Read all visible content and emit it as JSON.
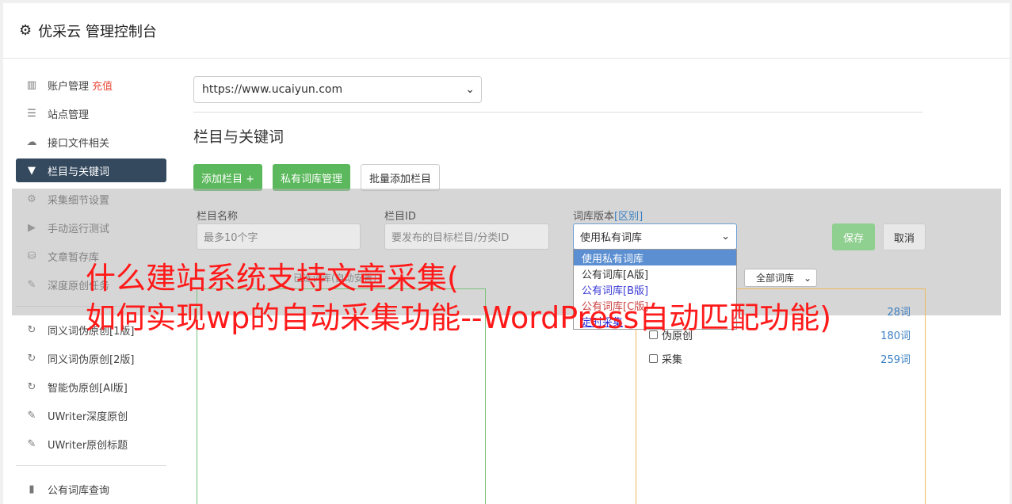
{
  "header": {
    "title": "优采云 管理控制台",
    "icon": "gear-icon"
  },
  "sidebar": {
    "groups": [
      [
        {
          "label": "账户管理",
          "extra": "充值",
          "icon": "bar-chart-icon",
          "glyph": "▥"
        },
        {
          "label": "站点管理",
          "icon": "server-icon",
          "glyph": "☰"
        },
        {
          "label": "接口文件相关",
          "icon": "cloud-upload-icon",
          "glyph": "☁"
        },
        {
          "label": "栏目与关键词",
          "icon": "filter-icon",
          "glyph": "▼",
          "active": true
        },
        {
          "label": "采集细节设置",
          "icon": "cogs-icon",
          "glyph": "⚙"
        },
        {
          "label": "手动运行测试",
          "icon": "play-icon",
          "glyph": "▶"
        },
        {
          "label": "文章暂存库",
          "icon": "database-icon",
          "glyph": "⛁"
        },
        {
          "label": "深度原创任务",
          "icon": "edit-icon",
          "glyph": "✎"
        }
      ],
      [
        {
          "label": "同义词伪原创[1版]",
          "icon": "refresh-icon",
          "glyph": "↻"
        },
        {
          "label": "同义词伪原创[2版]",
          "icon": "refresh-icon",
          "glyph": "↻"
        },
        {
          "label": "智能伪原创[AI版]",
          "icon": "refresh-icon",
          "glyph": "↻"
        },
        {
          "label": "UWriter深度原创",
          "icon": "edit-icon",
          "glyph": "✎"
        },
        {
          "label": "UWriter原创标题",
          "icon": "edit-icon",
          "glyph": "✎"
        }
      ],
      [
        {
          "label": "公有词库查询",
          "icon": "book-icon",
          "glyph": "▮"
        }
      ]
    ]
  },
  "main": {
    "site_select": "https://www.ucaiyun.com",
    "section_title": "栏目与关键词",
    "buttons": {
      "add_column": "添加栏目 +",
      "private_lib": "私有词库管理",
      "batch_add": "批量添加栏目"
    },
    "form": {
      "col_name_label": "栏目名称",
      "col_name_placeholder": "最多10个字",
      "col_id_label": "栏目ID",
      "col_id_placeholder": "要发布的目标栏目/分类ID",
      "lib_version_label": "词库版本",
      "lib_version_link": "[区别]",
      "lib_version_value": "使用私有词库",
      "save": "保存",
      "cancel": "取消"
    },
    "dropdown_options": [
      {
        "label": "使用私有词库",
        "style": "selected"
      },
      {
        "label": "公有词库[A版]",
        "style": ""
      },
      {
        "label": "公有词库[B版]",
        "style": "blue"
      },
      {
        "label": "公有词库[C版]",
        "style": "red"
      },
      {
        "label": "定时采集",
        "style": "link"
      }
    ],
    "hint_left": "已选词库(自动安置)",
    "lib_filter": "全部词库",
    "lib_rows": [
      {
        "name": "",
        "count": "28词"
      },
      {
        "name": "伪原创",
        "count": "180词"
      },
      {
        "name": "采集",
        "count": "259词"
      }
    ]
  },
  "watermark": {
    "line1": "什么建站系统支持文章采集(",
    "line2": "如何实现wp的自动采集功能--WordPress自动匹配功能)"
  }
}
